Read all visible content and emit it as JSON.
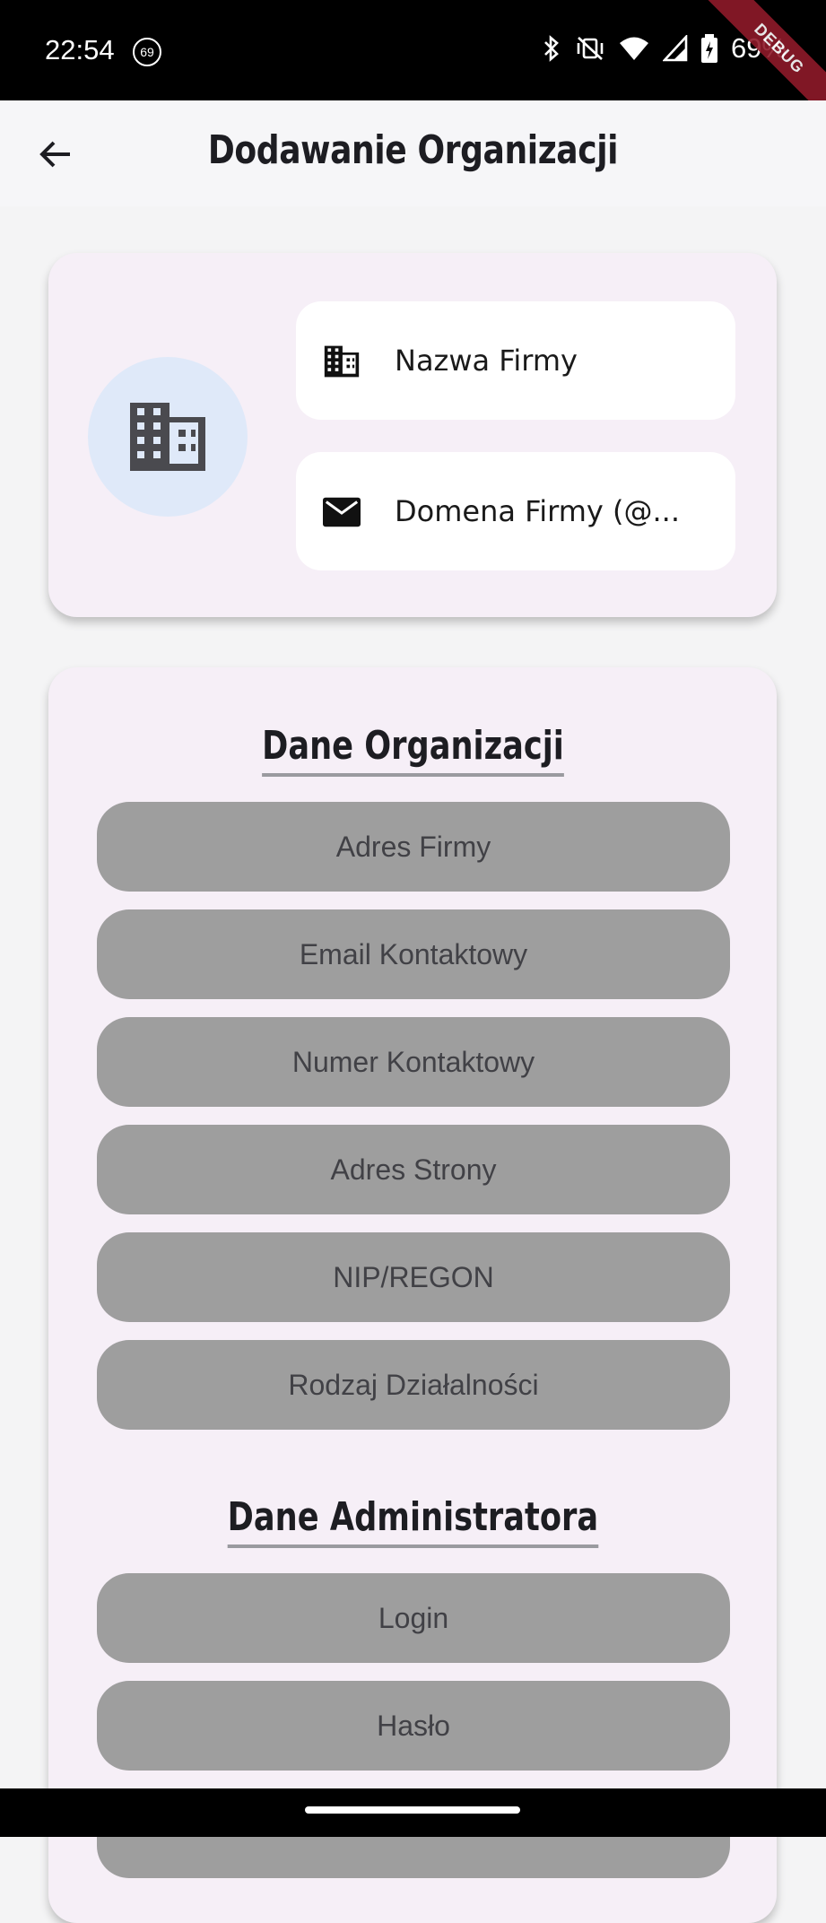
{
  "status_bar": {
    "time": "22:54",
    "notification_badge": "69",
    "battery_percent": "69%",
    "icons": [
      "bluetooth-icon",
      "vibrate-off-icon",
      "wifi-icon",
      "signal-icon",
      "battery-charging-icon"
    ]
  },
  "debug_banner": "DEBUG",
  "app_bar": {
    "title": "Dodawanie Organizacji",
    "back_icon": "arrow-back-icon"
  },
  "header_card": {
    "avatar_icon": "building-icon",
    "company_name_placeholder": "Nazwa Firmy",
    "company_domain_placeholder": "Domena Firmy (@..."
  },
  "organization_section": {
    "heading": "Dane Organizacji",
    "fields": [
      "Adres Firmy",
      "Email Kontaktowy",
      "Numer Kontaktowy",
      "Adres Strony",
      "NIP/REGON",
      "Rodzaj Działalności"
    ]
  },
  "admin_section": {
    "heading": "Dane Administratora",
    "fields": [
      "Login",
      "Hasło"
    ]
  },
  "colors": {
    "background": "#f4f4f5",
    "card": "#f6eff7",
    "pill": "#9e9e9e",
    "avatar": "#dfe9f9",
    "debug": "#8e1a2a"
  }
}
